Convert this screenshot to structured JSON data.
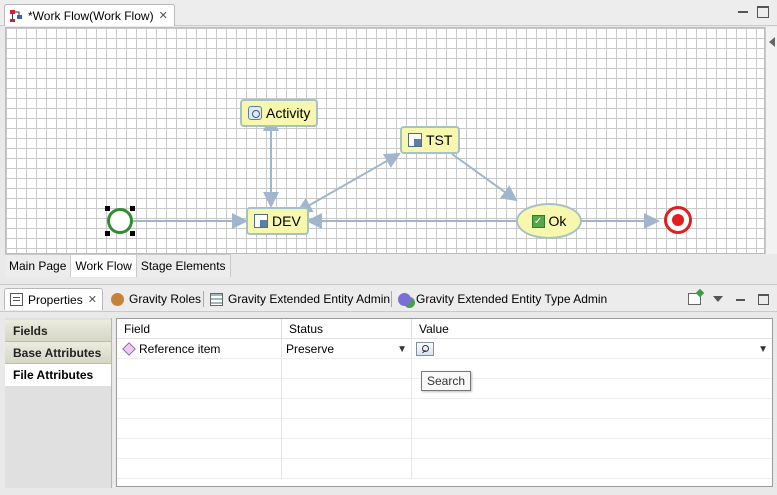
{
  "editor": {
    "tab_title": "*Work Flow(Work Flow)",
    "tab_icon": "workflow-icon"
  },
  "workflow": {
    "nodes": {
      "activity": "Activity",
      "tst": "TST",
      "dev": "DEV",
      "ok": "Ok"
    },
    "colors": {
      "node_fill": "#f7f7ad",
      "node_border": "#a6c2c7",
      "connector": "#9fb6cc",
      "start": "#2e8f2e",
      "end": "#e11f1f"
    }
  },
  "page_tabs": [
    "Main Page",
    "Work Flow",
    "Stage Elements"
  ],
  "views": {
    "tabs": [
      {
        "label": "Properties",
        "icon": "properties-icon"
      },
      {
        "label": "Gravity Roles",
        "icon": "roles-icon"
      },
      {
        "label": "Gravity Extended Entity Admin",
        "icon": "entity-admin-icon"
      },
      {
        "label": "Gravity Extended Entity Type Admin",
        "icon": "entity-type-icon"
      }
    ]
  },
  "properties": {
    "categories": [
      "Fields",
      "Base Attributes",
      "File Attributes"
    ],
    "table": {
      "headers": [
        "Field",
        "Status",
        "Value"
      ],
      "rows": [
        {
          "field": "Reference item",
          "status": "Preserve",
          "value": ""
        }
      ]
    },
    "tooltip": "Search"
  }
}
